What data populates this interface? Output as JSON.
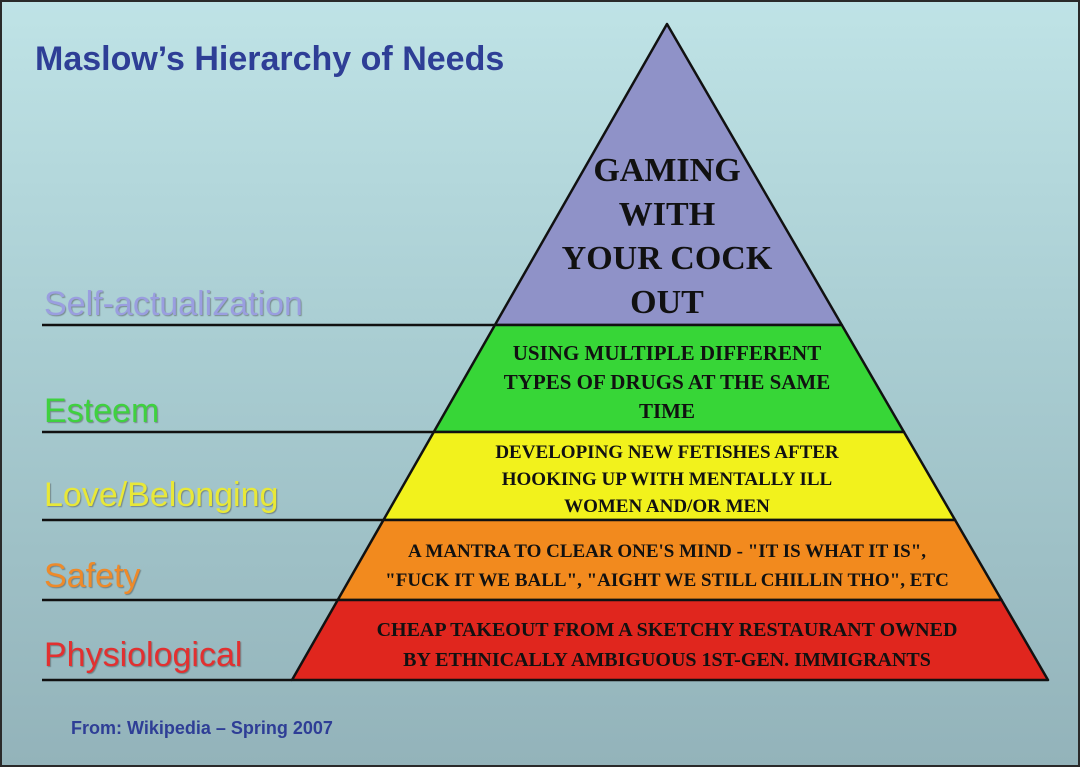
{
  "title": "Maslow’s Hierarchy of Needs",
  "source": "From: Wikipedia – Spring 2007",
  "levels": [
    {
      "label": "Self-actualization",
      "label_color": "#9a9ee0",
      "fill": "#8f92c8",
      "lines": [
        "GAMING",
        "WITH",
        "YOUR COCK",
        "OUT"
      ]
    },
    {
      "label": "Esteem",
      "label_color": "#3fd13f",
      "fill": "#37d637",
      "lines": [
        "USING MULTIPLE DIFFERENT",
        "TYPES OF DRUGS AT THE SAME",
        "TIME"
      ]
    },
    {
      "label": "Love/Belonging",
      "label_color": "#e8e838",
      "fill": "#f2f21c",
      "lines": [
        "DEVELOPING NEW FETISHES AFTER",
        "HOOKING UP WITH MENTALLY ILL",
        "WOMEN AND/OR MEN"
      ]
    },
    {
      "label": "Safety",
      "label_color": "#ee8a2a",
      "fill": "#f28a1e",
      "lines": [
        "A MANTRA TO CLEAR ONE'S MIND - \"IT IS WHAT IT IS\",",
        "\"FUCK IT WE BALL\", \"AIGHT WE STILL CHILLIN THO\", ETC"
      ]
    },
    {
      "label": "Physiological",
      "label_color": "#e23030",
      "fill": "#e0261e",
      "lines": [
        "CHEAP TAKEOUT FROM A SKETCHY RESTAURANT OWNED",
        "BY ETHNICALLY AMBIGUOUS 1ST-GEN. IMMIGRANTS"
      ]
    }
  ]
}
